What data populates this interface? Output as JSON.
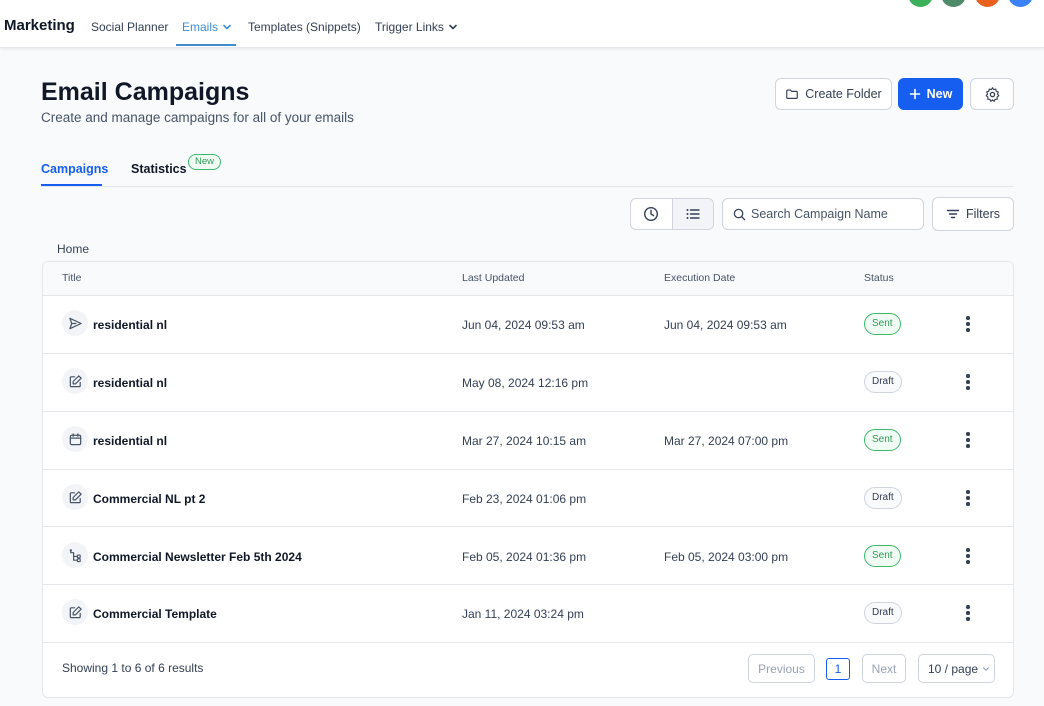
{
  "nav": {
    "brand": "Marketing",
    "items": [
      {
        "label": "Social Planner"
      },
      {
        "label": "Emails"
      },
      {
        "label": "Templates (Snippets)"
      },
      {
        "label": "Trigger Links"
      }
    ],
    "avatar_colors": [
      "#3cb15a",
      "#4f8a6a",
      "#e9611e",
      "#3b82f6"
    ]
  },
  "header": {
    "title": "Email Campaigns",
    "subtitle": "Create and manage campaigns for all of your emails",
    "create_folder": "Create Folder",
    "new": "New"
  },
  "tabs": {
    "campaigns": "Campaigns",
    "statistics": "Statistics",
    "new_badge": "New"
  },
  "toolbar": {
    "search_placeholder": "Search Campaign Name",
    "filters": "Filters"
  },
  "breadcrumb": "Home",
  "table": {
    "columns": {
      "title": "Title",
      "last_updated": "Last Updated",
      "execution_date": "Execution Date",
      "status": "Status"
    },
    "rows": [
      {
        "icon": "send-icon",
        "title": "residential nl",
        "last_updated": "Jun 04, 2024 09:53 am",
        "execution_date": "Jun 04, 2024 09:53 am",
        "status": "Sent"
      },
      {
        "icon": "edit-icon",
        "title": "residential nl",
        "last_updated": "May 08, 2024 12:16 pm",
        "execution_date": "",
        "status": "Draft"
      },
      {
        "icon": "calendar-icon",
        "title": "residential nl",
        "last_updated": "Mar 27, 2024 10:15 am",
        "execution_date": "Mar 27, 2024 07:00 pm",
        "status": "Sent"
      },
      {
        "icon": "edit-icon",
        "title": "Commercial NL pt 2",
        "last_updated": "Feb 23, 2024 01:06 pm",
        "execution_date": "",
        "status": "Draft"
      },
      {
        "icon": "workflow-icon",
        "title": "Commercial Newsletter Feb 5th 2024",
        "last_updated": "Feb 05, 2024 01:36 pm",
        "execution_date": "Feb 05, 2024 03:00 pm",
        "status": "Sent"
      },
      {
        "icon": "edit-icon",
        "title": "Commercial Template",
        "last_updated": "Jan 11, 2024 03:24 pm",
        "execution_date": "",
        "status": "Draft"
      }
    ]
  },
  "pagination": {
    "summary": "Showing 1 to 6 of 6 results",
    "previous": "Previous",
    "page": "1",
    "next": "Next",
    "page_size": "10 / page"
  }
}
